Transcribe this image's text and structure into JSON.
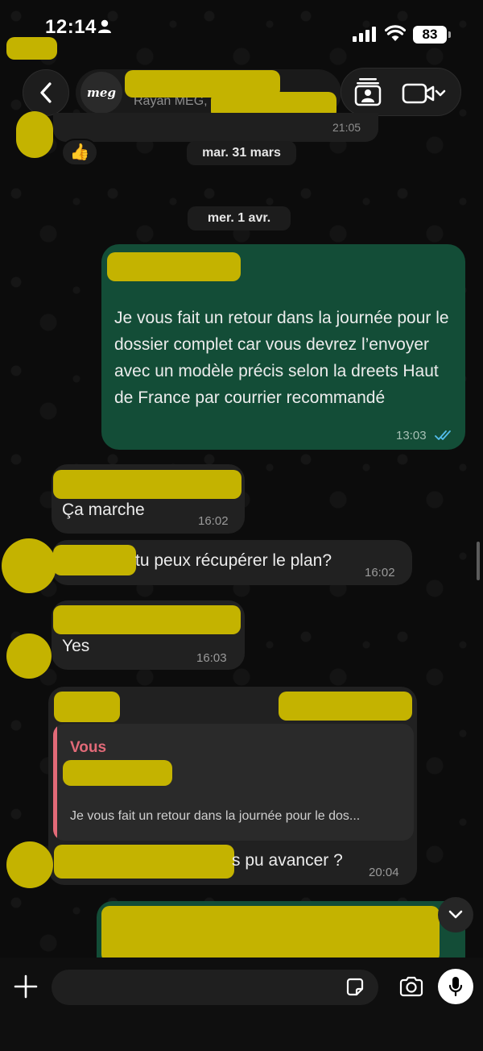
{
  "status_bar": {
    "time": "12:14",
    "battery": "83"
  },
  "header": {
    "avatar_text": "meg",
    "subtitle": "Rayan MEG,"
  },
  "top_message": {
    "time": "21:05",
    "reaction": "👍"
  },
  "dates": {
    "first": "mar. 31 mars",
    "second": "mer. 1 avr."
  },
  "messages": [
    {
      "id": "out1",
      "direction": "outgoing",
      "text": "Je vous fait un retour dans la journée pour le dossier complet car vous devrez l’envoyer avec un modèle précis selon la dreets Haut de France par courrier recommandé",
      "time": "13:03",
      "status": "read"
    },
    {
      "id": "in1",
      "direction": "incoming",
      "text": "Ça marche",
      "time": "16:02"
    },
    {
      "id": "in2",
      "direction": "incoming",
      "text": "tu peux récupérer le plan?",
      "time": "16:02"
    },
    {
      "id": "in3",
      "direction": "incoming",
      "text": "Yes",
      "time": "16:03"
    },
    {
      "id": "in4",
      "direction": "incoming",
      "quote_author": "Vous",
      "quote_text": "Je vous fait un retour dans la journée pour le dos...",
      "text": "s pu avancer ?",
      "time": "20:04"
    }
  ],
  "composer": {
    "placeholder": ""
  },
  "colors": {
    "outgoing_bubble": "#134d37",
    "incoming_bubble": "#212121",
    "quote_accent": "#e26a78",
    "read_ticks": "#53bdeb",
    "redaction": "#c4b300"
  }
}
